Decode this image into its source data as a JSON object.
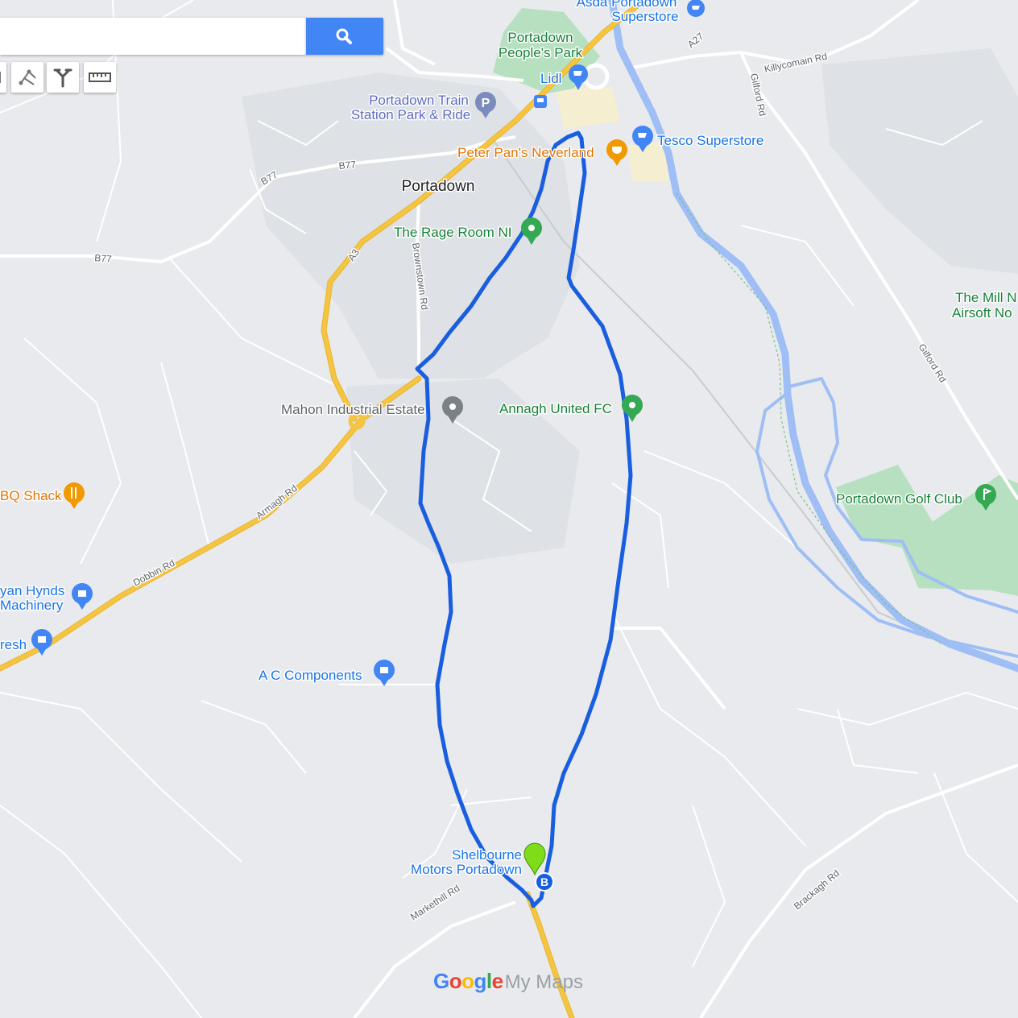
{
  "search": {
    "placeholder": ""
  },
  "tools": [
    {
      "icon": "select-hand-icon"
    },
    {
      "icon": "add-marker-icon"
    },
    {
      "icon": "draw-line-icon"
    },
    {
      "icon": "add-directions-icon"
    },
    {
      "icon": "measure-ruler-icon"
    }
  ],
  "places": {
    "asda_1": "Asda Portadown",
    "asda_2": "Superstore",
    "park_1": "Portadown",
    "park_2": "People's Park",
    "lidl": "Lidl",
    "train_1": "Portadown Train",
    "train_2": "Station Park & Ride",
    "peter_pan": "Peter Pan's Neverland",
    "tesco": "Tesco Superstore",
    "portadown": "Portadown",
    "rage_room": "The Rage Room NI",
    "mill_1": "The Mill N",
    "mill_2": "Airsoft No",
    "mahon": "Mahon Industrial Estate",
    "annagh": "Annagh United FC",
    "bbq": "BQ Shack",
    "golf": "Portadown Golf Club",
    "hynds_1": "yan Hynds",
    "hynds_2": "Machinery",
    "fresh": "resh",
    "ac": "A C Components",
    "shelbourne_1": "Shelbourne",
    "shelbourne_2": "Motors Portadown"
  },
  "roads": {
    "a27": "A27",
    "killycomain": "Killycomain Rd",
    "gilford_1": "Gilford Rd",
    "gilford_2": "Gilford Rd",
    "b77_a": "B77",
    "b77_b": "B77",
    "b77_c": "B77",
    "a3": "A3",
    "brownstown": "Brownstown Rd",
    "armagh": "Armagh Rd",
    "dobbin": "Dobbin Rd",
    "markethill": "Markethill Rd",
    "brackagh": "Brackagh Rd"
  },
  "route": {
    "end_marker": "B",
    "color": "#1a5ee0"
  },
  "colors": {
    "background": "#e8eaed",
    "water": "#9ebef5",
    "park": "#b7e0c0",
    "major_road": "#f5c542",
    "route": "#1a5ee0",
    "poi_green": "#34a853",
    "poi_blue": "#4285f4",
    "poi_orange": "#f29900",
    "marker": "#7cdd18"
  },
  "brand": {
    "google": "Google",
    "mymaps": "My Maps"
  }
}
